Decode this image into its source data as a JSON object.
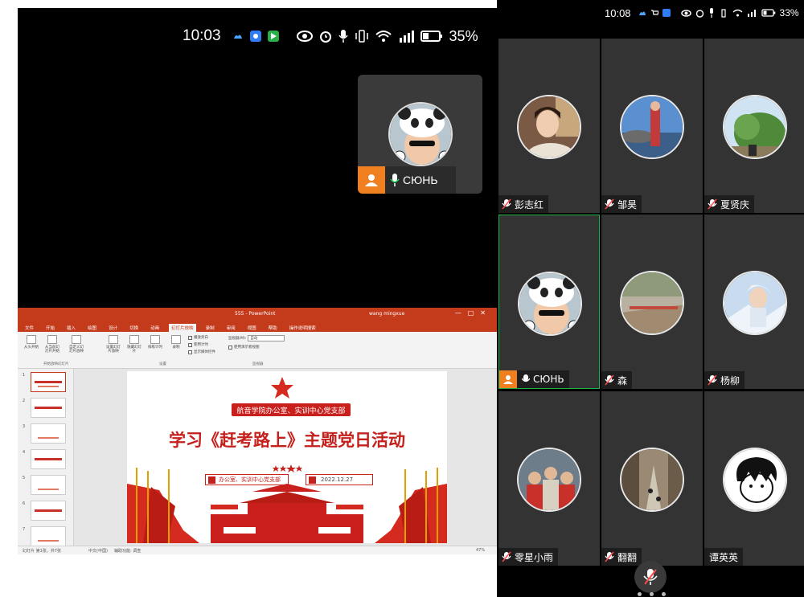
{
  "left_screen": {
    "status": {
      "time": "10:03",
      "battery": "35%"
    },
    "self_preview": {
      "name": "СЮНЬ"
    }
  },
  "ppt": {
    "window_title": "555 - PowerPoint",
    "user_name": "wang mingxue",
    "tabs": [
      "文件",
      "开始",
      "插入",
      "绘图",
      "设计",
      "切换",
      "动画",
      "幻灯片放映",
      "录制",
      "审阅",
      "视图",
      "帮助",
      "操作说明搜索"
    ],
    "active_tab_index": 7,
    "ribbon": {
      "from_start": "从头开始",
      "from_current": "从当前幻灯片开始",
      "custom_show": "自定义幻灯片放映",
      "setup_show": "设置幻灯片放映",
      "hide_slide": "隐藏幻灯片",
      "rehearse": "排练计时",
      "record": "录制",
      "chk_narration": "播放旁白",
      "chk_timing": "使用计时",
      "chk_media": "显示媒体控件",
      "monitor_label": "监视器(M):",
      "monitor_value": "自动",
      "chk_presenter": "使用演示者视图",
      "group_start": "开始放映幻灯片",
      "group_setup": "设置",
      "group_monitor": "监视器"
    },
    "thumb_numbers": [
      "1",
      "2",
      "3",
      "4",
      "5",
      "6",
      "7"
    ],
    "slide": {
      "org": "航音学院办公室、实训中心党支部",
      "headline": "学习《赶考路上》主题党日活动",
      "meta_left": "办公室、实训中心党支部",
      "meta_date": "2022.12.27"
    },
    "status": {
      "slide_count": "幻灯片 第1张，共7张",
      "lang": "中文(中国)",
      "access": "辅助功能: 调查",
      "zoom": "47%"
    }
  },
  "right_screen": {
    "status": {
      "time": "10:08",
      "battery": "33%"
    },
    "participants": [
      {
        "name": "彭志红"
      },
      {
        "name": "邹昊"
      },
      {
        "name": "夏贤庆"
      },
      {
        "name": "СЮНЬ"
      },
      {
        "name": "森"
      },
      {
        "name": "杨柳"
      },
      {
        "name": "零星小雨"
      },
      {
        "name": "翻翻"
      },
      {
        "name": "谭英英"
      }
    ]
  },
  "colors": {
    "ppt_red": "#c43b1c",
    "active_tile_border": "#1fb24a",
    "self_badge": "#f07f1f",
    "tile_bg": "#333333"
  }
}
